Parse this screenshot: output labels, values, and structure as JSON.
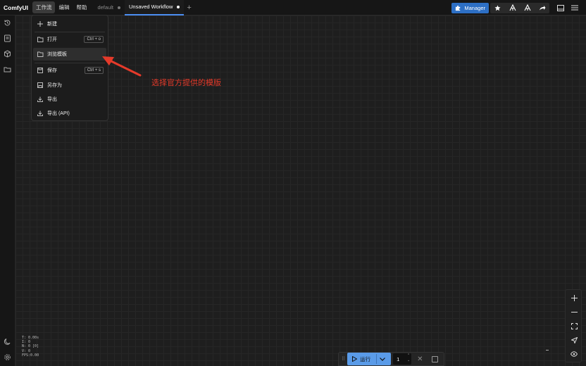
{
  "app": {
    "logo": "ComfyUI",
    "menu": [
      "工作流",
      "编辑",
      "帮助"
    ],
    "tabs": [
      {
        "label": "default",
        "active": false
      },
      {
        "label": "Unsaved Workflow",
        "active": true
      }
    ],
    "manager_label": "Manager",
    "accent_color": "#2d6fc4"
  },
  "dropdown": {
    "items": [
      {
        "label": "新建",
        "icon": "plus-icon"
      },
      {
        "label": "打开",
        "icon": "folder-open-icon",
        "shortcut": "Ctrl + o"
      },
      {
        "label": "浏览模板",
        "icon": "folder-open-icon",
        "highlighted": true
      },
      {
        "label": "保存",
        "icon": "save-icon",
        "shortcut": "Ctrl + s"
      },
      {
        "label": "另存为",
        "icon": "save-as-icon"
      },
      {
        "label": "导出",
        "icon": "download-icon"
      },
      {
        "label": "导出 (API)",
        "icon": "download-icon"
      }
    ]
  },
  "annotation": {
    "text": "选择官方提供的模版",
    "color": "#e53a2a"
  },
  "stats": [
    "T: 0.00s",
    "I: 0",
    "N: 0 [0]",
    "V: 0",
    "FPS:0.00"
  ],
  "runbar": {
    "run_label": "运行",
    "count": "1",
    "run_color": "#5a9be8"
  }
}
